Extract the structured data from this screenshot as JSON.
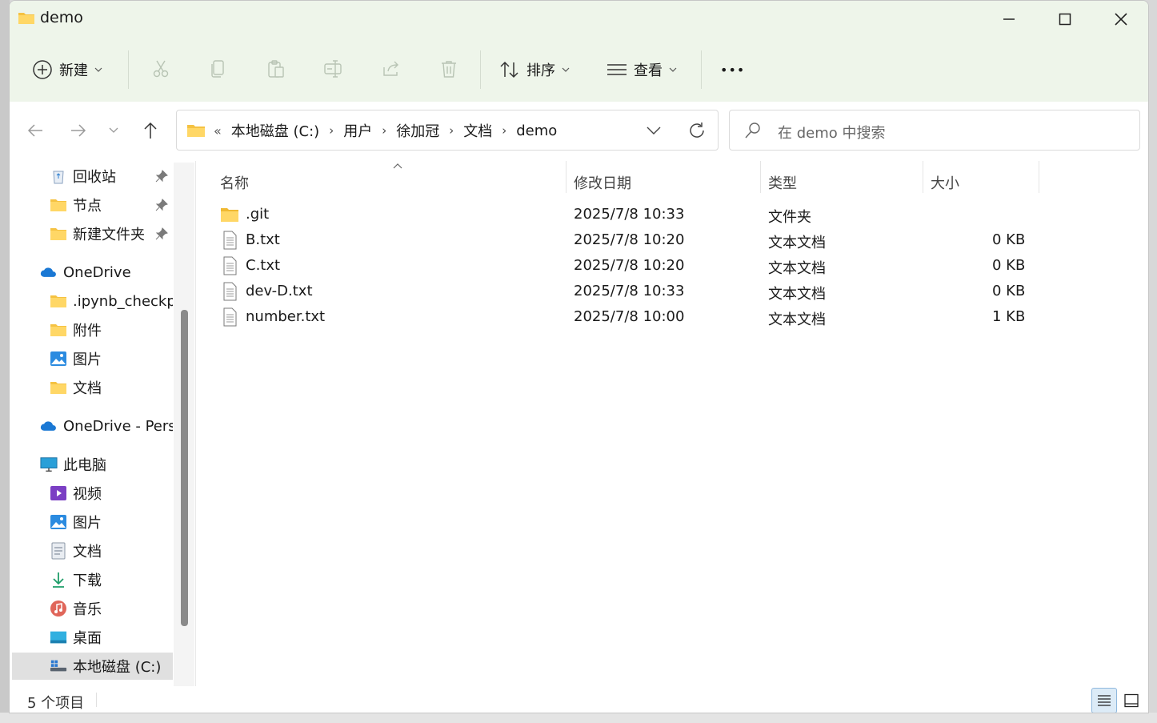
{
  "window": {
    "title": "demo"
  },
  "toolbar": {
    "new_label": "新建",
    "sort_label": "排序",
    "view_label": "查看",
    "more_label": "•••"
  },
  "address": {
    "overflow": "«",
    "crumbs": [
      "本地磁盘 (C:)",
      "用户",
      "徐加冠",
      "文档",
      "demo"
    ]
  },
  "search": {
    "placeholder": "在 demo 中搜索"
  },
  "sidebar": {
    "items": [
      {
        "label": "回收站",
        "icon": "recycle-bin-icon",
        "pinned": true
      },
      {
        "label": "节点",
        "icon": "folder-icon",
        "pinned": true
      },
      {
        "label": "新建文件夹",
        "icon": "folder-icon",
        "pinned": true
      },
      {
        "label": "OneDrive",
        "icon": "cloud-icon"
      },
      {
        "label": ".ipynb_checkpoints",
        "icon": "folder-icon"
      },
      {
        "label": "附件",
        "icon": "folder-icon"
      },
      {
        "label": "图片",
        "icon": "pictures-icon"
      },
      {
        "label": "文档",
        "icon": "folder-icon"
      },
      {
        "label": "OneDrive - Personal",
        "icon": "cloud-icon"
      },
      {
        "label": "此电脑",
        "icon": "computer-icon"
      },
      {
        "label": "视频",
        "icon": "video-icon"
      },
      {
        "label": "图片",
        "icon": "pictures-icon"
      },
      {
        "label": "文档",
        "icon": "document-icon"
      },
      {
        "label": "下载",
        "icon": "download-icon"
      },
      {
        "label": "音乐",
        "icon": "music-icon"
      },
      {
        "label": "桌面",
        "icon": "desktop-icon"
      },
      {
        "label": "本地磁盘 (C:)",
        "icon": "drive-icon",
        "selected": true
      }
    ]
  },
  "columns": {
    "name": "名称",
    "modified": "修改日期",
    "type": "类型",
    "size": "大小"
  },
  "files": [
    {
      "name": ".git",
      "modified": "2025/7/8 10:33",
      "type": "文件夹",
      "size": "",
      "icon": "folder-icon"
    },
    {
      "name": "B.txt",
      "modified": "2025/7/8 10:20",
      "type": "文本文档",
      "size": "0 KB",
      "icon": "text-file-icon"
    },
    {
      "name": "C.txt",
      "modified": "2025/7/8 10:20",
      "type": "文本文档",
      "size": "0 KB",
      "icon": "text-file-icon"
    },
    {
      "name": "dev-D.txt",
      "modified": "2025/7/8 10:33",
      "type": "文本文档",
      "size": "0 KB",
      "icon": "text-file-icon"
    },
    {
      "name": "number.txt",
      "modified": "2025/7/8 10:00",
      "type": "文本文档",
      "size": "1 KB",
      "icon": "text-file-icon"
    }
  ],
  "status": {
    "item_count": "5 个项目"
  },
  "colors": {
    "titlebar_bg": "#eef5ea",
    "folder": "#f5c242",
    "accent": "#0067c0"
  }
}
